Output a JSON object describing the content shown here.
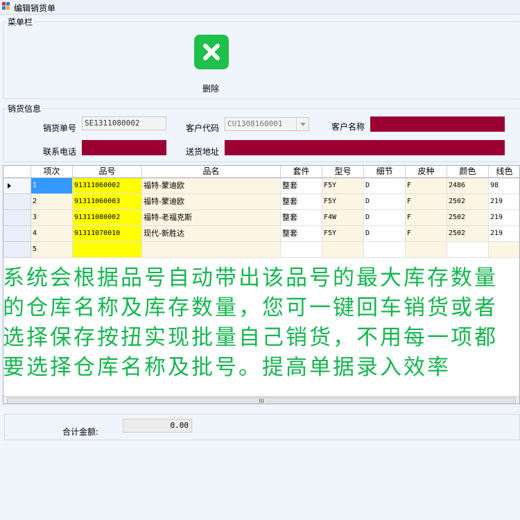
{
  "window": {
    "title": "编辑销货单"
  },
  "menubar": {
    "label": "菜单栏",
    "delete_label": "删除"
  },
  "info": {
    "section_label": "销货信息",
    "order_no_label": "销货单号",
    "order_no": "SE1311080002",
    "customer_code_label": "客户代码",
    "customer_code": "CU1308160001",
    "customer_name_label": "客户名称",
    "phone_label": "联系电话",
    "address_label": "送货地址"
  },
  "grid": {
    "columns": [
      "项次",
      "品号",
      "品名",
      "套件",
      "型号",
      "细节",
      "皮种",
      "颜色",
      "线色"
    ],
    "rows": [
      [
        "1",
        "91311060002",
        "福特-蒙迪欧",
        "整套",
        "F5Y",
        "D",
        "F",
        "2486",
        "98"
      ],
      [
        "2",
        "91311060003",
        "福特-蒙迪欧",
        "整套",
        "F5Y",
        "D",
        "F",
        "2502",
        "219"
      ],
      [
        "3",
        "91311080002",
        "福特-老福克斯",
        "整套",
        "F4W",
        "D",
        "F",
        "2502",
        "219"
      ],
      [
        "4",
        "91311070010",
        "现代-新胜达",
        "整套",
        "F5Y",
        "D",
        "F",
        "2502",
        "219"
      ],
      [
        "5",
        "",
        "",
        "",
        "",
        "",
        "",
        "",
        ""
      ]
    ],
    "scroll_grip": "III"
  },
  "overlay_text": "系统会根据品号自动带出该品号的最大库存数量的仓库名称及库存数量，您可一键回车销货或者选择保存按扭实现批量自己销货，不用每一项都要选择仓库名称及批号。提高单据录入效率",
  "footer": {
    "total_label": "合计金额:",
    "total_value": "0.00"
  },
  "colors": {
    "accent_green": "#1fbf4b",
    "overlay_text": "#15b64f",
    "redaction": "#9b0032",
    "highlight_yellow": "#ffff00",
    "row_cream": "#fdf5e3"
  },
  "icons": {
    "delete": "close-x-icon",
    "app": "app-icon"
  }
}
